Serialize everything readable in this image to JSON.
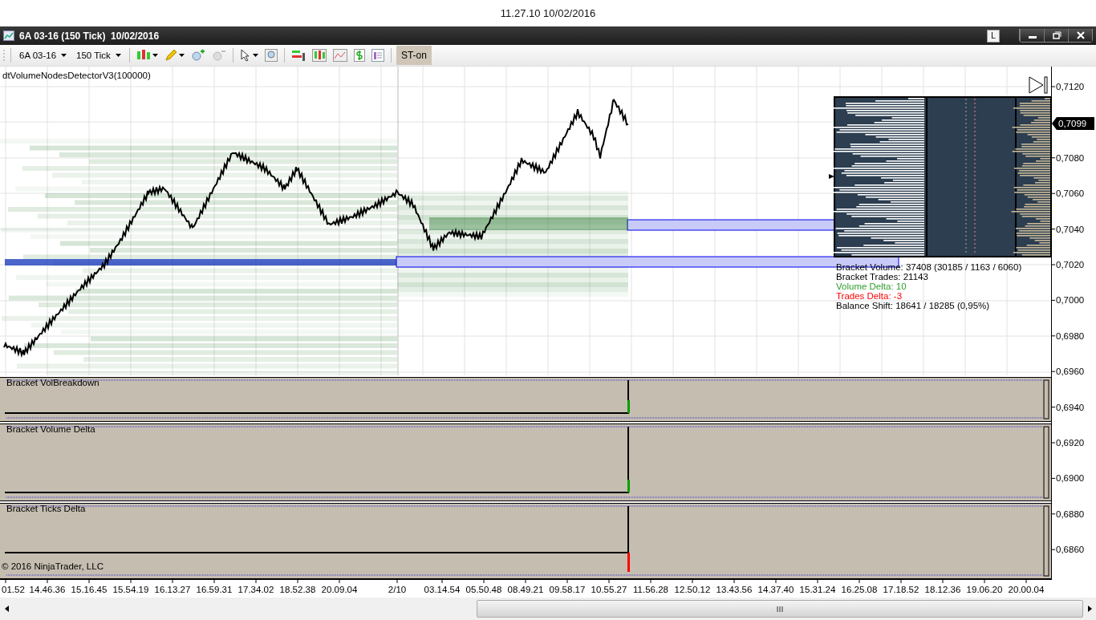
{
  "clock": "11.27.10 10/02/2016",
  "window": {
    "title": "6A 03-16 (150 Tick)  10/02/2016",
    "link_button": "L"
  },
  "toolbar": {
    "instrument": "6A 03-16",
    "interval": "150 Tick",
    "strategy_button": {
      "label": "ST-on",
      "pressed": true
    }
  },
  "indicator_label": "dtVolumeNodesDetectorV3(100000)",
  "price_axis": {
    "ticks": [
      "0,7120",
      "0,7080",
      "0,7060",
      "0,7040",
      "0,7020",
      "0,7000",
      "0,6980",
      "0,6960",
      "0,6940",
      "0,6920",
      "0,6900",
      "0,6880",
      "0,6860"
    ],
    "last_price": "0,7099"
  },
  "info_lines": [
    {
      "text": "Bracket Volume: 37408 (30185 / 1163 / 6060)",
      "color": "#000000"
    },
    {
      "text": "Bracket Trades: 21143",
      "color": "#000000"
    },
    {
      "text": "Volume Delta: 10",
      "color": "#2e9e2e"
    },
    {
      "text": "Trades Delta: -3",
      "color": "#ff0000"
    },
    {
      "text": "Balance Shift: 18641 / 18285 (0,95%)",
      "color": "#000000"
    }
  ],
  "panels": [
    {
      "title": "Bracket VolBreakdown"
    },
    {
      "title": "Bracket Volume Delta"
    },
    {
      "title": "Bracket Ticks Delta"
    }
  ],
  "copyright": "© 2016 NinjaTrader, LLC",
  "time_axis": [
    "01.52",
    "14.46.36",
    "15.16.45",
    "15.54.19",
    "16.13.27",
    "16.59.31",
    "17.34.02",
    "18.52.38",
    "20.09.04",
    "2/10",
    "03.14.54",
    "05.50.48",
    "08.49.21",
    "09.58.17",
    "10.55.27",
    "11.56.28",
    "12.50.12",
    "13.43.56",
    "14.37.40",
    "15.31.24",
    "16.25.08",
    "17.18.52",
    "18.12.36",
    "19.06.20",
    "20.00.04"
  ]
}
